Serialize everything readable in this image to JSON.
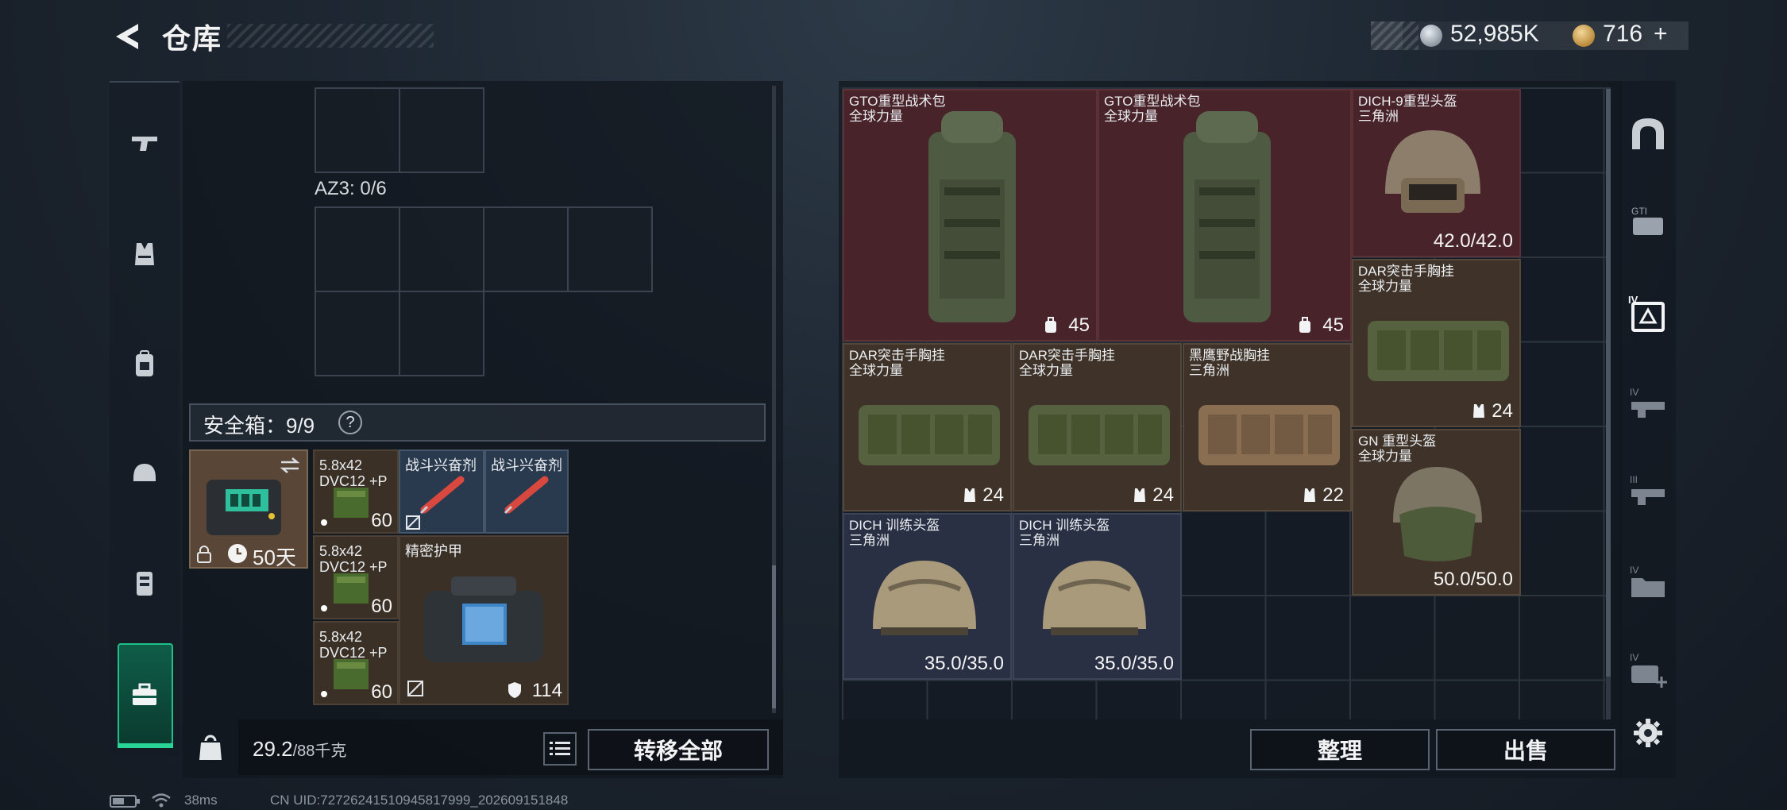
{
  "header": {
    "title": "仓库",
    "silver_amount": "52,985K",
    "gold_amount": "716",
    "gold_plus": "+",
    "accent_color": "#28d597"
  },
  "left_nav": {
    "items": [
      {
        "icon": "pistol-icon"
      },
      {
        "icon": "vest-icon"
      },
      {
        "icon": "backpack-icon"
      },
      {
        "icon": "helmet-icon"
      },
      {
        "icon": "armor-plate-icon"
      },
      {
        "icon": "toolbox-icon",
        "active": true
      }
    ]
  },
  "container": {
    "az3_label": "AZ3: 0/6"
  },
  "safebox": {
    "label": "安全箱：9/9",
    "help": "?",
    "case_timer": "50天",
    "tiles": [
      {
        "name_line1": "5.8x42",
        "name_line2": "DVC12 +P",
        "count": "60"
      },
      {
        "name": "战斗兴奋剂"
      },
      {
        "name": "战斗兴奋剂"
      },
      {
        "name_line1": "5.8x42",
        "name_line2": "DVC12 +P",
        "count": "60"
      },
      {
        "name": "精密护甲",
        "value": "114"
      },
      {
        "name_line1": "5.8x42",
        "name_line2": "DVC12 +P",
        "count": "60"
      }
    ]
  },
  "footer_left": {
    "weight_value": "29.2",
    "weight_unit": "/88千克",
    "transfer_all": "转移全部"
  },
  "stash_items": [
    {
      "name": "GTO重型战术包",
      "sub": "全球力量",
      "value": "45",
      "color": "red"
    },
    {
      "name": "GTO重型战术包",
      "sub": "全球力量",
      "value": "45",
      "color": "red"
    },
    {
      "name": "DICH-9重型头盔",
      "sub": "三角洲",
      "value": "42.0/42.0",
      "color": "red"
    },
    {
      "name": "DAR突击手胸挂",
      "sub": "全球力量",
      "value": "24",
      "color": "brown"
    },
    {
      "name": "DAR突击手胸挂",
      "sub": "全球力量",
      "value": "24",
      "color": "brown"
    },
    {
      "name": "DAR突击手胸挂",
      "sub": "全球力量",
      "value": "24",
      "color": "brown"
    },
    {
      "name": "黑鹰野战胸挂",
      "sub": "三角洲",
      "value": "22",
      "color": "brown"
    },
    {
      "name": "GN 重型头盔",
      "sub": "全球力量",
      "value": "50.0/50.0",
      "color": "brown"
    },
    {
      "name": "DICH 训练头盔",
      "sub": "三角洲",
      "value": "35.0/35.0",
      "color": "navy"
    },
    {
      "name": "DICH 训练头盔",
      "sub": "三角洲",
      "value": "35.0/35.0",
      "color": "navy"
    }
  ],
  "footer_right": {
    "sort": "整理",
    "sell": "出售"
  },
  "right_nav": {
    "tier_labels": [
      "GTI",
      "IV",
      "IV",
      "III",
      "IV",
      "IV"
    ]
  },
  "status": {
    "ping": "38ms",
    "uid": "CN UID:7272624151094581​7999_202609151848"
  }
}
